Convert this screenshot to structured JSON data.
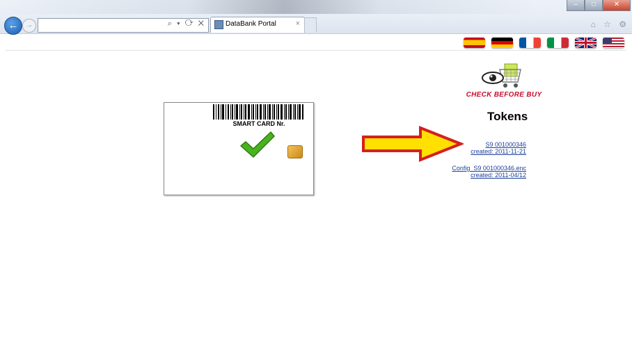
{
  "browser": {
    "tab_title": "DataBank Portal",
    "tab_close": "×",
    "address_tools": "⌕ ▾ ⟳ ✕",
    "back_glyph": "←",
    "forward_glyph": "→",
    "toolbar_icons": "⌂ ☆ ⚙",
    "window_buttons": [
      "–",
      "□",
      "✕"
    ]
  },
  "flags": [
    {
      "name": "es-flag",
      "country": "Spain"
    },
    {
      "name": "de-flag",
      "country": "Germany"
    },
    {
      "name": "fr-flag",
      "country": "France"
    },
    {
      "name": "it-flag",
      "country": "Italy"
    },
    {
      "name": "uk-flag",
      "country": "United Kingdom"
    },
    {
      "name": "us-flag",
      "country": "United States"
    }
  ],
  "logo": {
    "text": "CHECK BEFORE BUY"
  },
  "tokens": {
    "heading": "Tokens",
    "items": [
      {
        "line1": "S9     001000346",
        "line2": "created: 2011-11-21"
      },
      {
        "line1": "Config_S9     001000346.enc",
        "line2": "created: 2011-04/12"
      }
    ]
  },
  "card": {
    "label": "SMART CARD Nr."
  },
  "colors": {
    "arrow_fill": "#ffe000",
    "arrow_stroke": "#d42020",
    "link": "#1c3f9a",
    "check": "#49b21d"
  }
}
